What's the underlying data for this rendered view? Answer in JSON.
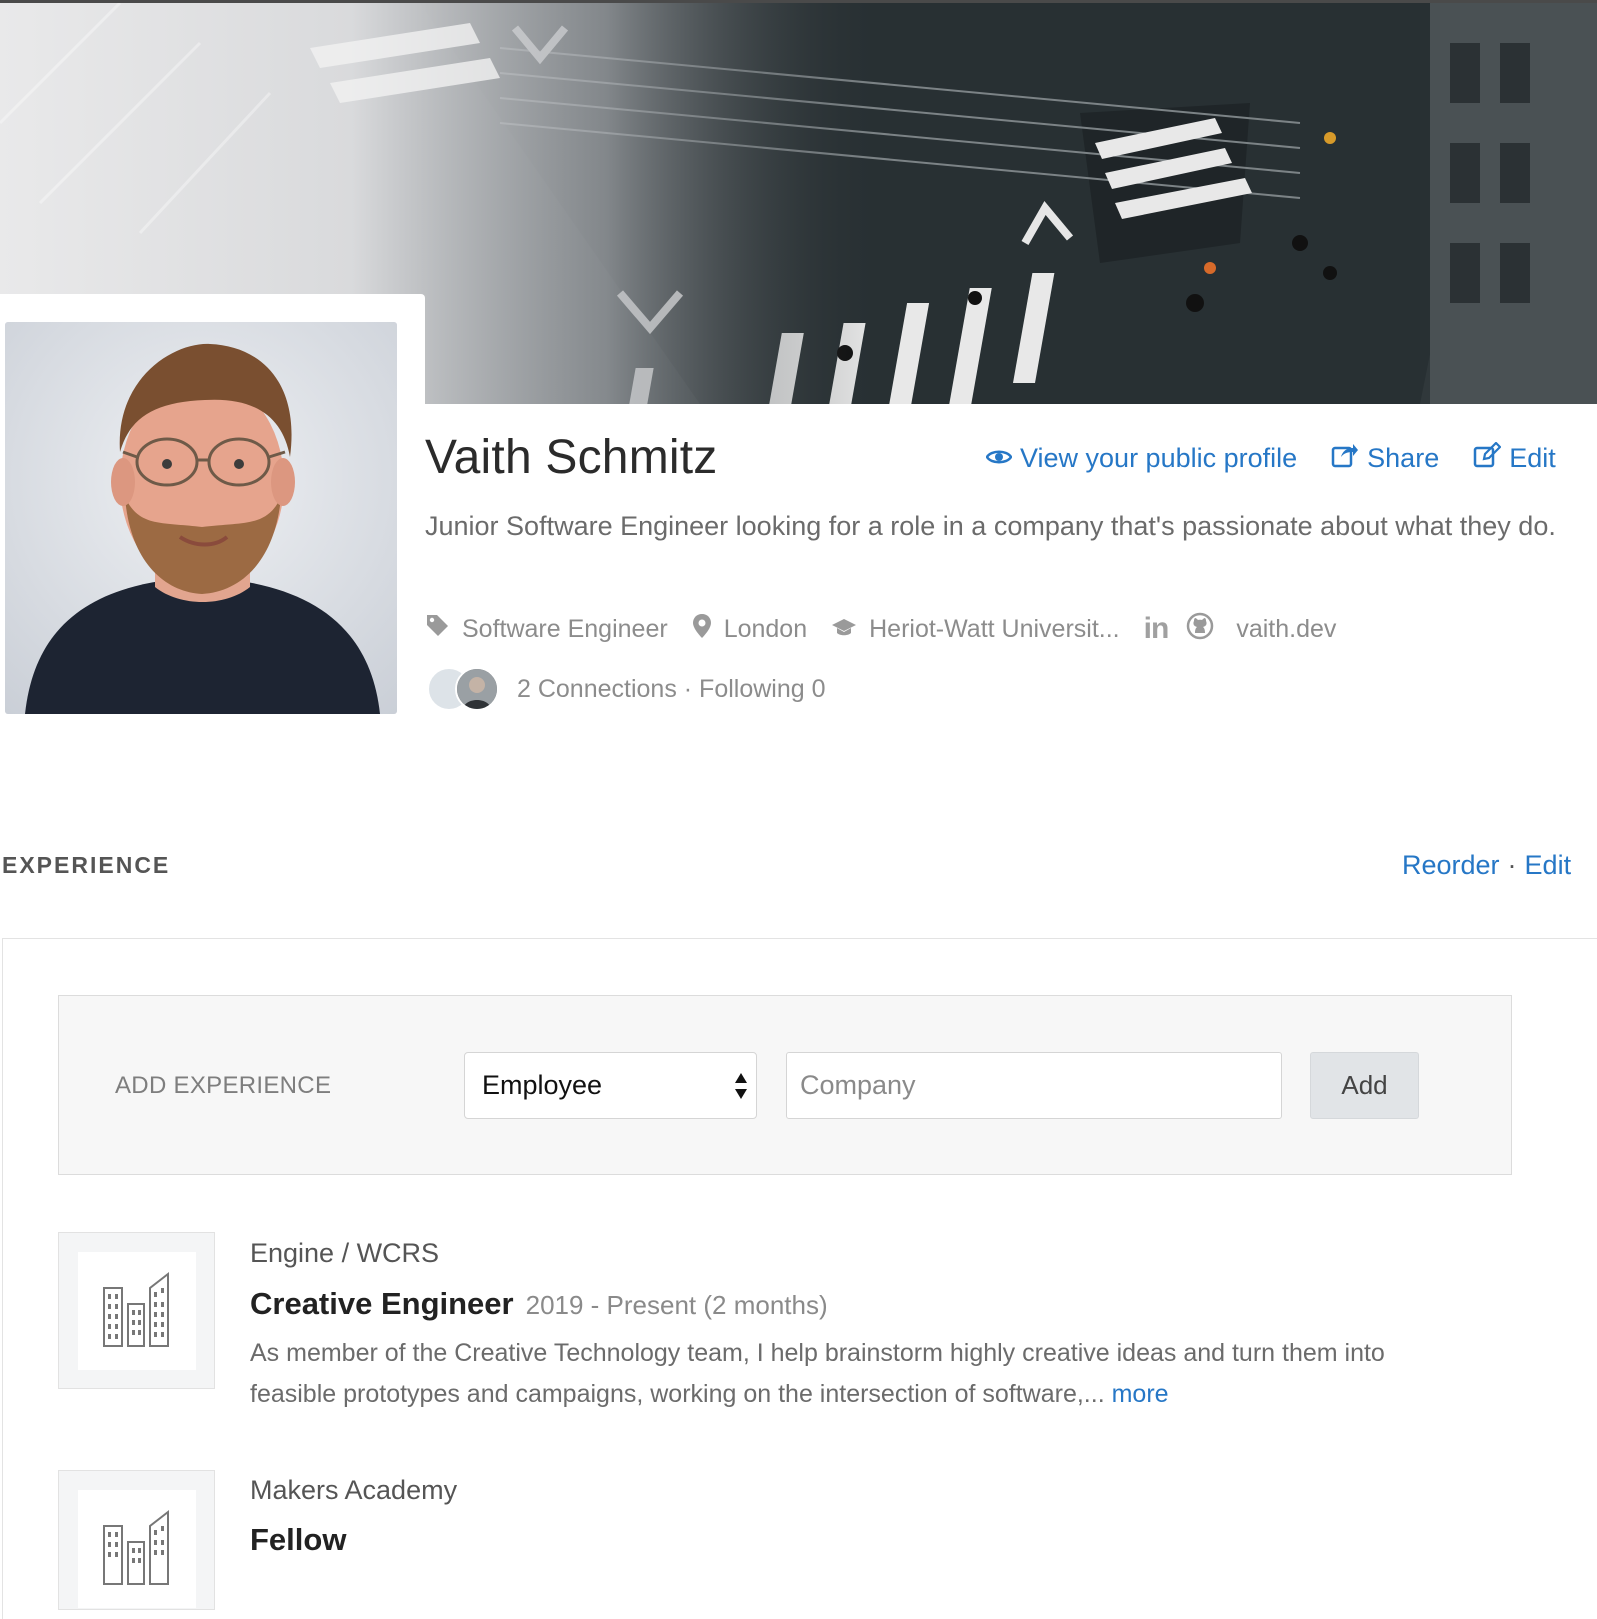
{
  "profile": {
    "name": "Vaith Schmitz",
    "tagline": "Junior Software Engineer looking for a role in a company that's passionate about what they do.",
    "role": "Software Engineer",
    "location": "London",
    "education": "Heriot-Watt Universit...",
    "linkedin_label": "in",
    "website": "vaith.dev",
    "connections": "2 Connections · Following 0"
  },
  "actions": {
    "view_public": "View your public profile",
    "share": "Share",
    "edit": "Edit"
  },
  "icons": {
    "view": "eye-icon",
    "share": "share-icon",
    "edit": "edit-icon",
    "role": "tag-icon",
    "location": "map-pin-icon",
    "education": "graduation-cap-icon",
    "linkedin": "linkedin-icon",
    "github": "github-icon",
    "company_logo": "buildings-icon"
  },
  "experience": {
    "title": "EXPERIENCE",
    "reorder": "Reorder",
    "separator": "·",
    "edit": "Edit",
    "add": {
      "label": "ADD EXPERIENCE",
      "type_value": "Employee",
      "company_placeholder": "Company",
      "button": "Add"
    },
    "items": [
      {
        "company": "Engine / WCRS",
        "role": "Creative Engineer",
        "dates": "2019 - Present (2 months)",
        "description": "As member of the Creative Technology team, I help brainstorm highly creative ideas and turn them into feasible prototypes and campaigns, working on the intersection of software,... ",
        "more": "more"
      },
      {
        "company": "Makers Academy",
        "role": "Fellow"
      }
    ]
  },
  "colors": {
    "link": "#2677c6",
    "text": "#333333",
    "muted": "#8c8c8c"
  }
}
